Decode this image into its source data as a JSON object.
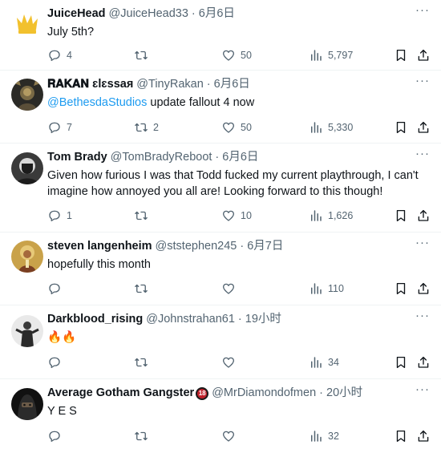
{
  "tweets": [
    {
      "name": "JuiceHead",
      "handle": "@JuiceHead33",
      "time": "6月6日",
      "text": "July 5th?",
      "replies": "4",
      "retweets": "",
      "likes": "50",
      "views": "5,797"
    },
    {
      "name": "𝐑𝐀𝐊𝐀𝐍 ɛlɛssaя",
      "handle": "@TinyRakan",
      "time": "6月6日",
      "mention": "@BethesdaStudios",
      "text": " update fallout 4 now",
      "replies": "7",
      "retweets": "2",
      "likes": "50",
      "views": "5,330"
    },
    {
      "name": "Tom Brady",
      "handle": "@TomBradyReboot",
      "time": "6月6日",
      "text": "Given how furious I was that Todd fucked my current playthrough, I can't imagine how annoyed you all are! Looking forward to this though!",
      "replies": "1",
      "retweets": "",
      "likes": "10",
      "views": "1,626"
    },
    {
      "name": "steven langenheim",
      "handle": "@ststephen245",
      "time": "6月7日",
      "text": "hopefully this month",
      "replies": "",
      "retweets": "",
      "likes": "",
      "views": "110"
    },
    {
      "name": "Darkblood_rising",
      "handle": "@Johnstrahan61",
      "time": "19小时",
      "text": "🔥🔥",
      "replies": "",
      "retweets": "",
      "likes": "",
      "views": "34"
    },
    {
      "name": "Average Gotham Gangster",
      "badge": "18",
      "handle": "@MrDiamondofmen",
      "time": "20小时",
      "text": "Y E S",
      "replies": "",
      "retweets": "",
      "likes": "",
      "views": "32"
    }
  ],
  "icons": {
    "more": "more-icon",
    "reply": "reply-icon",
    "retweet": "retweet-icon",
    "like": "heart-icon",
    "views": "views-icon",
    "bookmark": "bookmark-icon",
    "share": "share-icon"
  },
  "colors": {
    "text": "#0f1419",
    "muted": "#536471",
    "link": "#1d9bf0",
    "divider": "#eff3f4"
  }
}
